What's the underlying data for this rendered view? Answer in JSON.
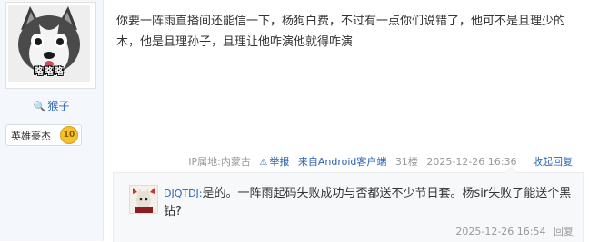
{
  "author": {
    "avatar_caption": "略略略",
    "avatar_icon": "husky-avatar",
    "username": "猴子",
    "user_icon": "user-icon",
    "badge_title": "英雄豪杰",
    "badge_level": "10"
  },
  "post": {
    "content": "你要一阵雨直播间还能信一下，杨狗白费，不过有一点你们说错了，他可不是且理少的木，他是且理孙子，且理让他咋演他就得咋演",
    "ip_location": "IP属地:内蒙古",
    "report_label": "举报",
    "report_icon": "warning-icon",
    "client": "来自Android客户端",
    "floor": "31楼",
    "timestamp": "2025-12-26 16:36",
    "collapse_label": "收起回复"
  },
  "reply": {
    "avatar_icon": "reply-user-avatar",
    "user": "DJQTDJ:",
    "text": "是的。一阵雨起码失败成功与否都送不少节日套。杨sir失败了能送个黑钻?",
    "timestamp": "2025-12-26 16:54",
    "reply_label": "回复"
  }
}
